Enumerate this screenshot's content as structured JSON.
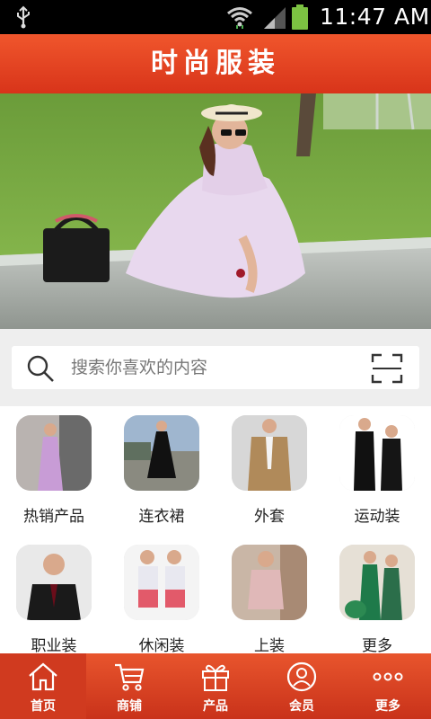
{
  "status_bar": {
    "time": "11:47 AM",
    "icons": [
      "usb-icon",
      "wifi-icon",
      "signal-icon",
      "battery-icon"
    ]
  },
  "header": {
    "title": "时尚服装"
  },
  "banner": {
    "slide_count": 5,
    "active_slide": 1
  },
  "search": {
    "placeholder": "搜索你喜欢的内容",
    "icons": [
      "search-icon",
      "scan-icon"
    ]
  },
  "categories": [
    {
      "label": "热销产品"
    },
    {
      "label": "连衣裙"
    },
    {
      "label": "外套"
    },
    {
      "label": "运动装"
    },
    {
      "label": "职业装"
    },
    {
      "label": "休闲装"
    },
    {
      "label": "上装"
    },
    {
      "label": "更多"
    }
  ],
  "tabbar": {
    "active": 0,
    "items": [
      {
        "label": "首页",
        "icon": "home-icon"
      },
      {
        "label": "商铺",
        "icon": "cart-icon"
      },
      {
        "label": "产品",
        "icon": "gift-icon"
      },
      {
        "label": "会员",
        "icon": "member-icon"
      },
      {
        "label": "更多",
        "icon": "more-icon"
      }
    ]
  },
  "colors": {
    "brand": "#e2461f",
    "status_bar": "#000000"
  }
}
